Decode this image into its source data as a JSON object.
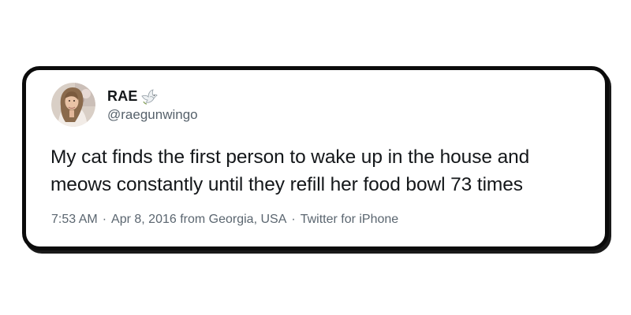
{
  "tweet": {
    "author": {
      "display_name": "RAE",
      "handle": "@raegunwingo",
      "name_emoji": "dove-icon",
      "avatar": "avatar-photo"
    },
    "text": "My cat finds the first person to wake up in the house and meows constantly until they refill her food bowl 73 times",
    "time": "7:53 AM",
    "separator": "·",
    "date_location": "Apr 8, 2016 from Georgia, USA",
    "source": "Twitter for iPhone"
  },
  "colors": {
    "card_border": "#0b0b0b",
    "text_primary": "#14171a",
    "text_secondary": "#5b6670",
    "background": "#ffffff"
  }
}
